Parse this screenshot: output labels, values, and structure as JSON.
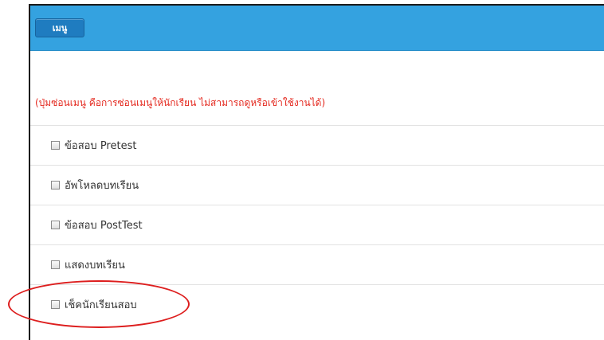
{
  "header": {
    "menu_button_label": "เมนู"
  },
  "note": "(ปุ่มซ่อนเมนู คือการซ่อนเมนูให้นักเรียน ไม่สามารถดูหรือเข้าใช้งานได้)",
  "menu_items": [
    {
      "label": "ข้อสอบ Pretest",
      "checked": false
    },
    {
      "label": "อัพโหลดบทเรียน",
      "checked": false
    },
    {
      "label": "ข้อสอบ PostTest",
      "checked": false
    },
    {
      "label": "แสดงบทเรียน",
      "checked": false
    },
    {
      "label": "เช็คนักเรียนสอบ",
      "checked": false
    }
  ],
  "colors": {
    "header": "#34a2e0",
    "button": "#1f7cc0",
    "note_text": "#e4281e",
    "highlight_circle": "#dd1e1e"
  }
}
